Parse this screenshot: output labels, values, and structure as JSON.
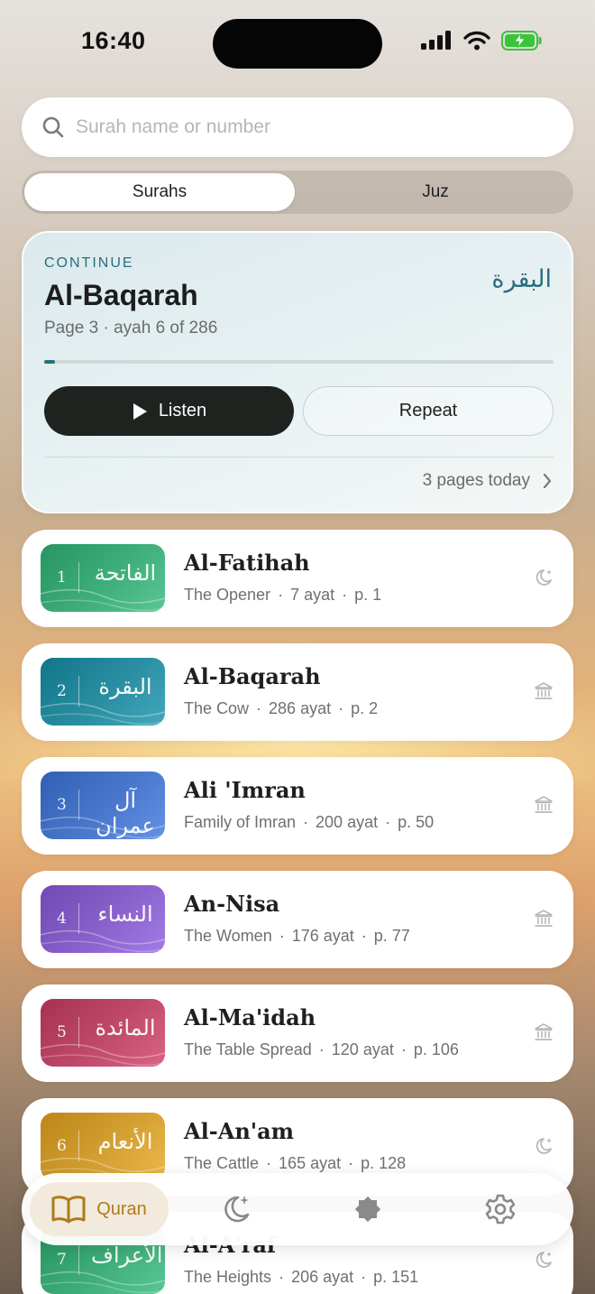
{
  "status_bar": {
    "time": "16:40"
  },
  "search": {
    "placeholder": "Surah name or number",
    "value": ""
  },
  "segments": {
    "active": "Surahs",
    "inactive": "Juz"
  },
  "continue_card": {
    "kicker": "CONTINUE",
    "title": "Al-Baqarah",
    "arabic": "البقرة",
    "subtitle": "Page 3 · ayah 6 of 286",
    "progress_fraction": 0.021,
    "listen_label": "Listen",
    "repeat_label": "Repeat",
    "today_label": "3 pages today"
  },
  "surahs": [
    {
      "number": "1",
      "arabic": "الفاتحة",
      "name": "Al-Fatihah",
      "meaning": "The Opener",
      "ayat": "7 ayat",
      "page": "p. 1",
      "type_icon": "moon-star-icon",
      "color": "#3fae7a"
    },
    {
      "number": "2",
      "arabic": "البقرة",
      "name": "Al-Baqarah",
      "meaning": "The Cow",
      "ayat": "286 ayat",
      "page": "p. 2",
      "type_icon": "building-columns-icon",
      "color": "#2a8fa2"
    },
    {
      "number": "3",
      "arabic": "آل عمران",
      "name": "Ali 'Imran",
      "meaning": "Family of Imran",
      "ayat": "200 ayat",
      "page": "p. 50",
      "type_icon": "building-columns-icon",
      "color": "#4a78cc"
    },
    {
      "number": "4",
      "arabic": "النساء",
      "name": "An-Nisa",
      "meaning": "The Women",
      "ayat": "176 ayat",
      "page": "p. 77",
      "type_icon": "building-columns-icon",
      "color": "#8a62cc"
    },
    {
      "number": "5",
      "arabic": "المائدة",
      "name": "Al-Ma'idah",
      "meaning": "The Table Spread",
      "ayat": "120 ayat",
      "page": "p. 106",
      "type_icon": "building-columns-icon",
      "color": "#c04a6a"
    },
    {
      "number": "6",
      "arabic": "الأنعام",
      "name": "Al-An'am",
      "meaning": "The Cattle",
      "ayat": "165 ayat",
      "page": "p. 128",
      "type_icon": "moon-star-icon",
      "color": "#d4a032"
    },
    {
      "number": "7",
      "arabic": "الأعراف",
      "name": "Al-A'raf",
      "meaning": "The Heights",
      "ayat": "206 ayat",
      "page": "p. 151",
      "type_icon": "moon-star-icon",
      "color": "#3fae7a"
    }
  ],
  "tabbar": {
    "active_label": "Quran",
    "tabs": [
      "book-open-icon",
      "moon-stars-icon",
      "eight-point-star-icon",
      "gear-icon"
    ]
  },
  "colors": {
    "accent_teal": "#2a6e7e",
    "accent_gold": "#b07a1c",
    "dark_button": "#1f2320"
  }
}
